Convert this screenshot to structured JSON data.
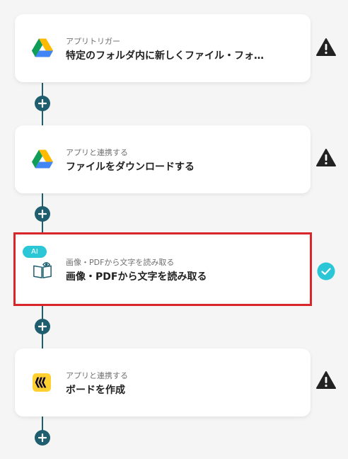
{
  "flow": {
    "steps": [
      {
        "subtitle": "アプリトリガー",
        "title": "特定のフォルダ内に新しくファイル・フォ…",
        "icon": "google-drive-icon",
        "status": "warning-icon"
      },
      {
        "subtitle": "アプリと連携する",
        "title": "ファイルをダウンロードする",
        "icon": "google-drive-icon",
        "status": "warning-icon"
      },
      {
        "badge": "AI",
        "subtitle": "画像・PDFから文字を読み取る",
        "title": "画像・PDFから文字を読み取る",
        "icon": "document-ocr-icon",
        "status": "check-icon"
      },
      {
        "subtitle": "アプリと連携する",
        "title": "ボードを作成",
        "icon": "miro-icon",
        "status": "warning-icon"
      }
    ],
    "add_step_icon": "plus-icon"
  },
  "colors": {
    "connector": "#1f5e6e",
    "ai_badge": "#2cc7d7",
    "check": "#2cc7d7",
    "warning": "#222222",
    "selection_border": "#d9262a",
    "miro_yellow": "#ffd02f"
  }
}
